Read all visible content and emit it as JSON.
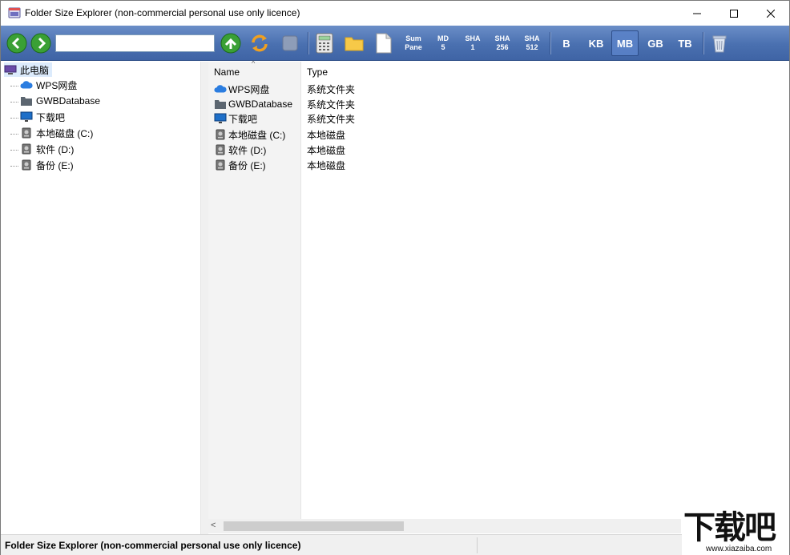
{
  "window": {
    "title": "Folder Size Explorer (non-commercial personal use only licence)"
  },
  "toolbar": {
    "path_value": "",
    "sum_pane": [
      "Sum",
      "Pane"
    ],
    "md5": [
      "MD",
      "5"
    ],
    "sha1": [
      "SHA",
      "1"
    ],
    "sha256": [
      "SHA",
      "256"
    ],
    "sha512": [
      "SHA",
      "512"
    ],
    "units": [
      "B",
      "KB",
      "MB",
      "GB",
      "TB"
    ],
    "active_unit": "MB"
  },
  "tree": {
    "root": "此电脑",
    "items": [
      {
        "label": "WPS网盘",
        "icon": "cloud-icon"
      },
      {
        "label": "GWBDatabase",
        "icon": "folder-icon"
      },
      {
        "label": "下载吧",
        "icon": "monitor-icon"
      },
      {
        "label": "本地磁盘 (C:)",
        "icon": "drive-icon"
      },
      {
        "label": "软件 (D:)",
        "icon": "drive-icon"
      },
      {
        "label": "备份 (E:)",
        "icon": "drive-icon"
      }
    ]
  },
  "list": {
    "columns": [
      "Name",
      "Type"
    ],
    "rows": [
      {
        "name": "WPS网盘",
        "type": "系统文件夹",
        "icon": "cloud-icon"
      },
      {
        "name": "GWBDatabase",
        "type": "系统文件夹",
        "icon": "folder-icon"
      },
      {
        "name": "下载吧",
        "type": "系统文件夹",
        "icon": "monitor-icon"
      },
      {
        "name": "本地磁盘 (C:)",
        "type": "本地磁盘",
        "icon": "drive-icon"
      },
      {
        "name": "软件 (D:)",
        "type": "本地磁盘",
        "icon": "drive-icon"
      },
      {
        "name": "备份 (E:)",
        "type": "本地磁盘",
        "icon": "drive-icon"
      }
    ]
  },
  "status": {
    "text": "Folder Size Explorer (non-commercial personal use only licence)"
  },
  "watermark": {
    "big": "下载吧",
    "url": "www.xiazaiba.com"
  },
  "colors": {
    "toolbar": "#4a70b0",
    "selection": "#dcebfc",
    "button_green": "#3aa035"
  }
}
